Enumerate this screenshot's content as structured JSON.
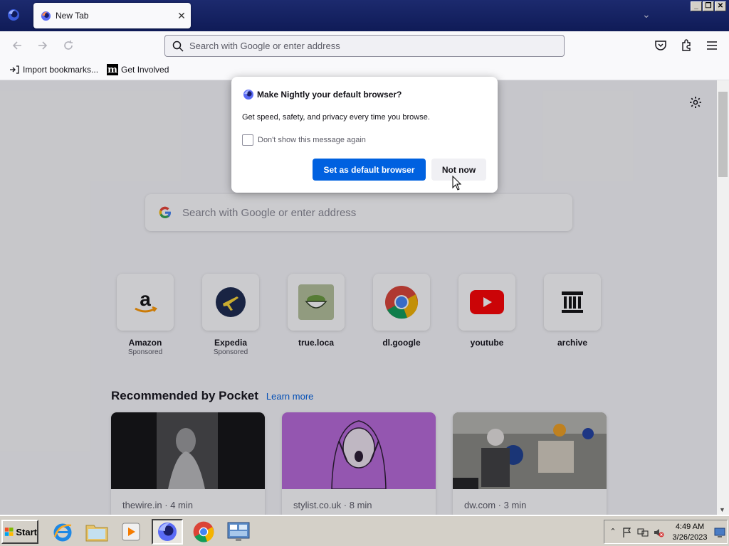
{
  "browser": {
    "tab_title": "New Tab",
    "url_placeholder": "Search with Google or enter address",
    "bookmarks": [
      {
        "label": "Import bookmarks...",
        "icon": "import-icon"
      },
      {
        "label": "Get Involved",
        "icon": "mozilla-m-icon"
      }
    ]
  },
  "newtab": {
    "search_placeholder": "Search with Google or enter address",
    "top_sites": [
      {
        "name": "Amazon",
        "sub": "Sponsored",
        "icon": "amazon-icon"
      },
      {
        "name": "Expedia",
        "sub": "Sponsored",
        "icon": "expedia-icon"
      },
      {
        "name": "true.loca",
        "sub": "",
        "icon": "true-loca-icon"
      },
      {
        "name": "dl.google",
        "sub": "",
        "icon": "chrome-icon"
      },
      {
        "name": "youtube",
        "sub": "",
        "icon": "youtube-icon"
      },
      {
        "name": "archive",
        "sub": "",
        "icon": "archive-icon"
      }
    ],
    "pocket": {
      "title": "Recommended by Pocket",
      "learn_more": "Learn more",
      "cards": [
        {
          "source": "thewire.in · 4 min"
        },
        {
          "source": "stylist.co.uk · 8 min"
        },
        {
          "source": "dw.com · 3 min"
        }
      ]
    }
  },
  "dialog": {
    "title": "Make Nightly your default browser?",
    "body": "Get speed, safety, and privacy every time you browse.",
    "checkbox_label": "Don't show this message again",
    "primary_button": "Set as default browser",
    "secondary_button": "Not now"
  },
  "taskbar": {
    "start_label": "Start",
    "time": "4:49 AM",
    "date": "3/26/2023"
  },
  "colors": {
    "accent": "#0061e0",
    "titlebar": "#1c2a6e",
    "taskbar": "#d4d0c8"
  }
}
